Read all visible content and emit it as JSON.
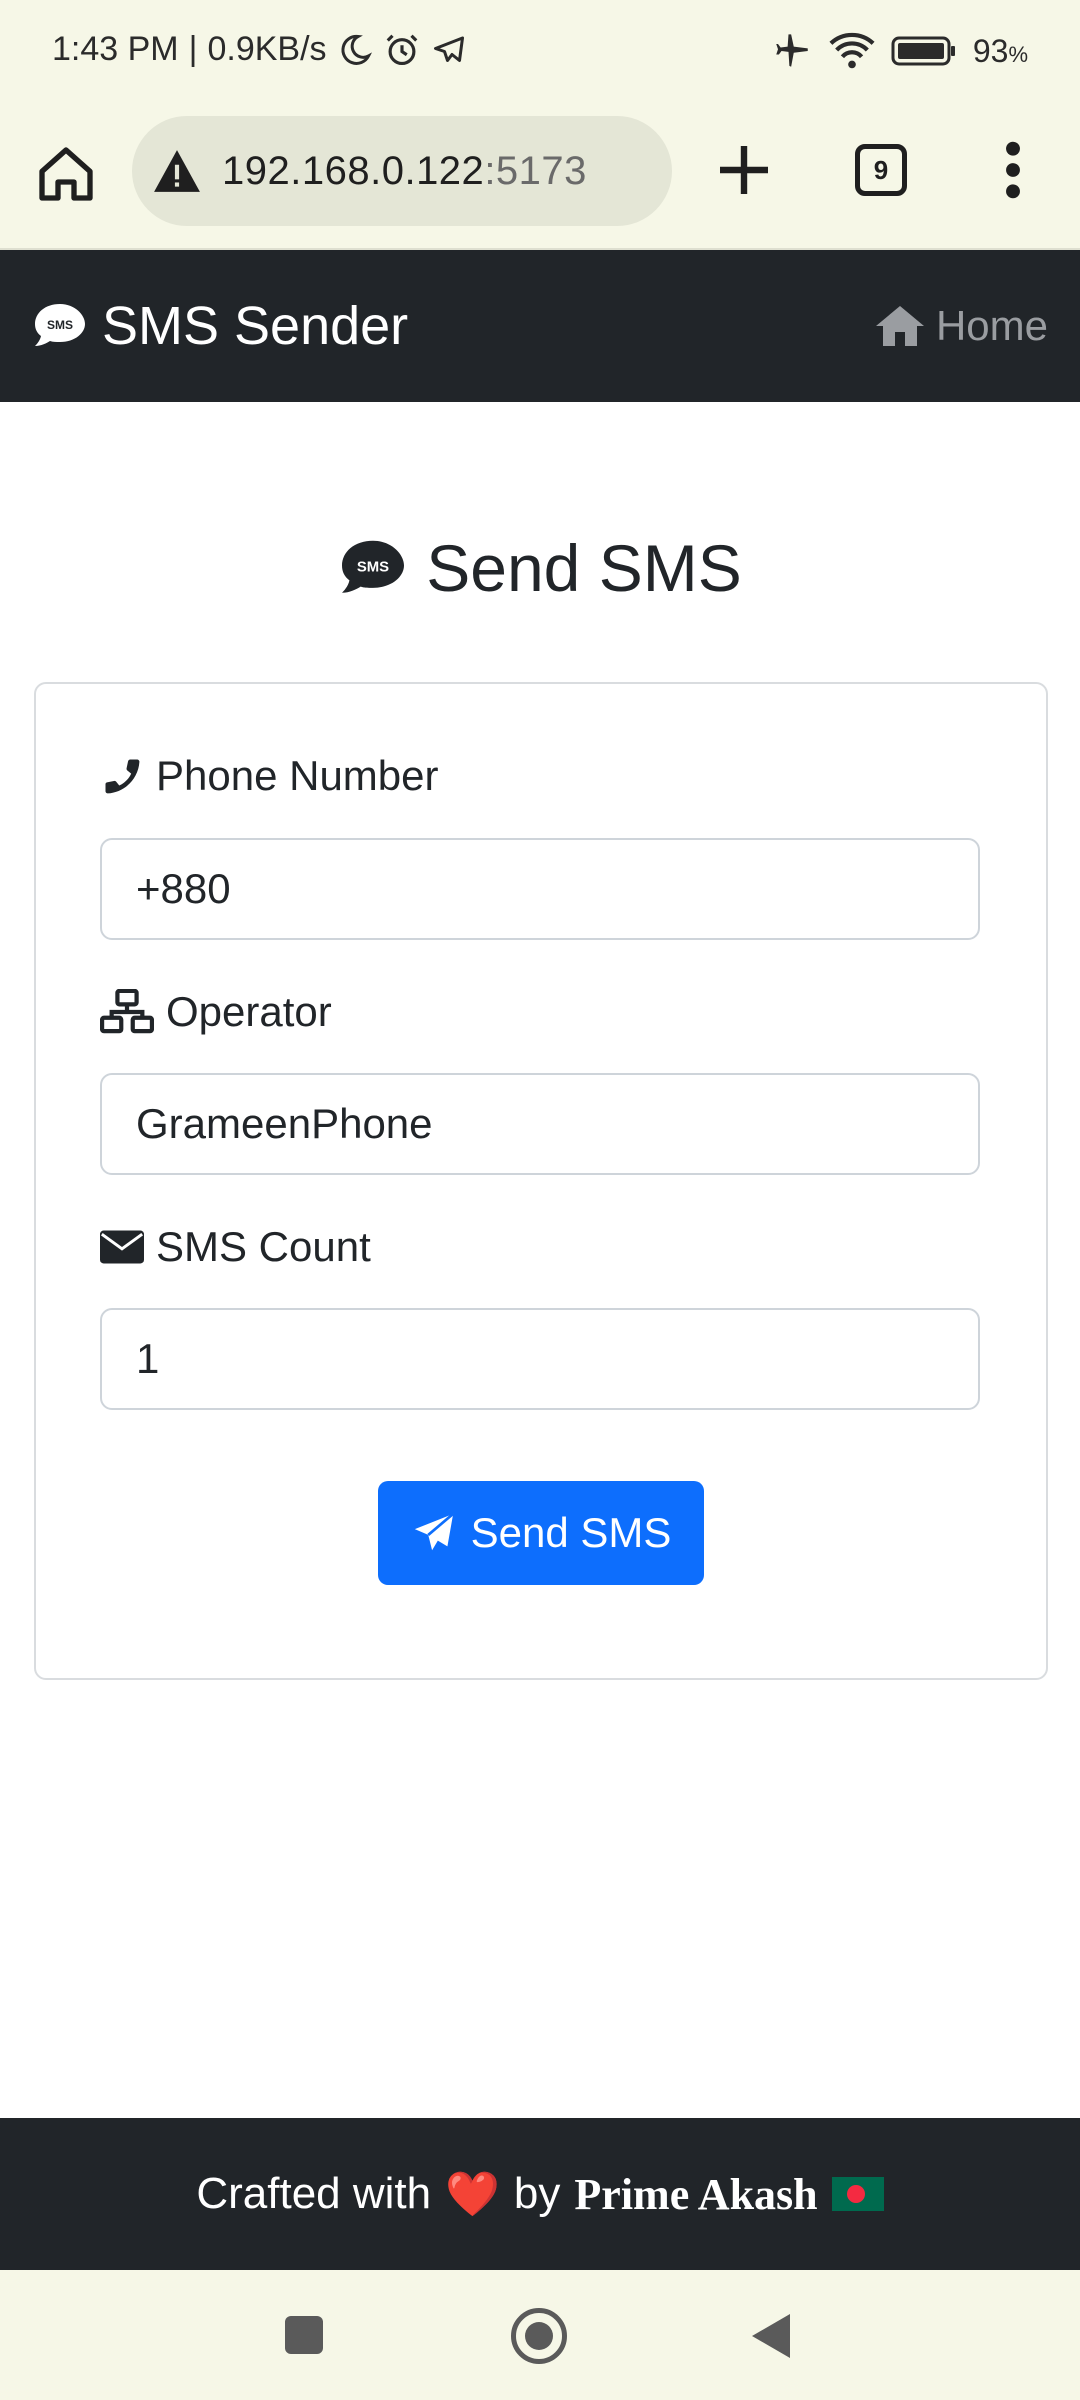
{
  "status_bar": {
    "time": "1:43 PM",
    "net_speed": "0.9KB/s",
    "battery_pct": "93",
    "battery_unit": "%"
  },
  "browser": {
    "url_host": "192.168.0.122",
    "url_port": ":5173",
    "tab_count": "9"
  },
  "navbar": {
    "brand": "SMS Sender",
    "home": "Home"
  },
  "main": {
    "title": "Send SMS",
    "phone_label": "Phone Number",
    "phone_value": "+880",
    "operator_label": "Operator",
    "operator_value": "GrameenPhone",
    "count_label": "SMS Count",
    "count_value": "1",
    "submit_label": "Send SMS"
  },
  "footer": {
    "prefix": "Crafted with",
    "heart": "❤️",
    "by": "by",
    "author": "Prime Akash"
  },
  "colors": {
    "navbar_bg": "#212529",
    "primary": "#0d6efd",
    "chrome_bg": "#f6f7e7"
  }
}
